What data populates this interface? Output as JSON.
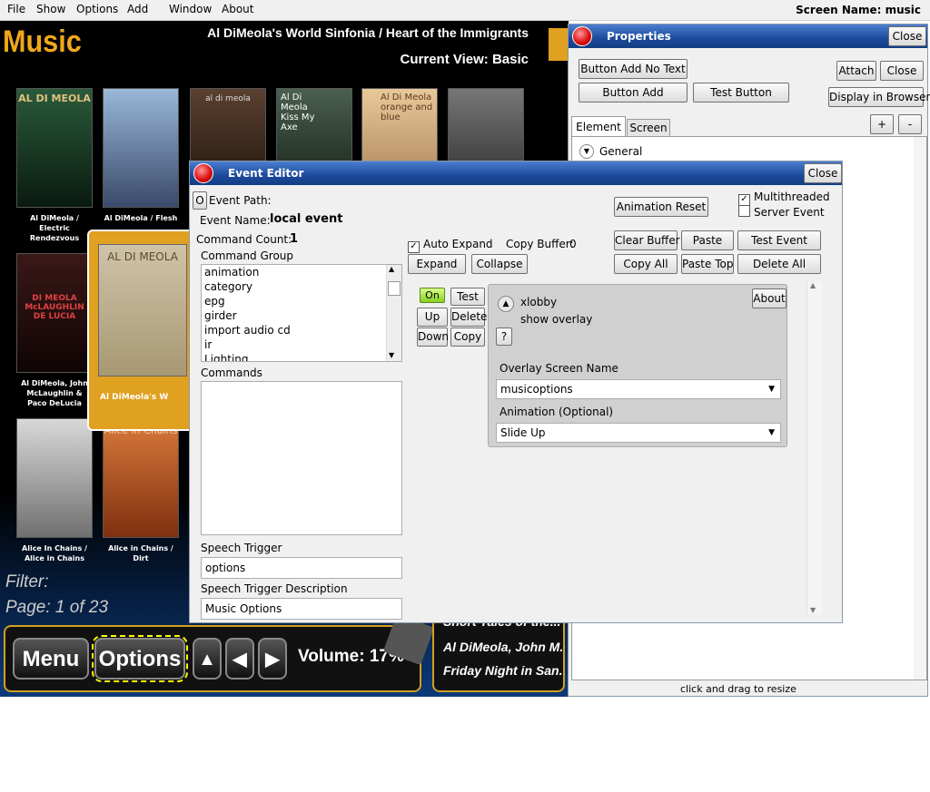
{
  "menubar": {
    "items": [
      "File",
      "Show",
      "Options",
      "Add",
      "Window",
      "About"
    ],
    "screen_name": "Screen Name: music"
  },
  "music": {
    "title": "Music",
    "now_playing": "Al DiMeola's World Sinfonia / Heart of the Immigrants",
    "current_view": "Current View: Basic",
    "albums": [
      {
        "caption": "Al DiMeola / Electric Rendezvous",
        "color": "#1a3a2a",
        "cover_text": "AL DI MEOLA"
      },
      {
        "caption": "Al DiMeola / Flesh on Flesh",
        "color": "#6a8aa8",
        "cover_text": ""
      },
      {
        "caption": "",
        "color": "#3a2a20",
        "cover_text": "al di meola"
      },
      {
        "caption": "",
        "color": "#2a3a30",
        "cover_text": "Al Di Meola Kiss My Axe"
      },
      {
        "caption": "",
        "color": "#c8a070",
        "cover_text": "Al Di Meola orange and blue"
      },
      {
        "caption": "",
        "color": "#444444",
        "cover_text": ""
      },
      {
        "caption": "Al DiMeola, John McLaughlin & Paco DeLucia",
        "color": "#2a1010",
        "cover_text": "DI MEOLA McLAUGHLIN DE LUCIA"
      },
      {
        "caption": "Alice In Chains / Alice in Chains",
        "color": "#bbbbbb",
        "cover_text": ""
      },
      {
        "caption": "Alice in Chains / Dirt",
        "color": "#c06030",
        "cover_text": "Alice in Chains"
      }
    ],
    "selected_album": {
      "caption": "Al DiMeola's W",
      "cover_text": "AL DI MEOLA"
    },
    "filter": "Filter:",
    "page": "Page: 1 of 23",
    "menu_btn": "Menu",
    "options_btn": "Options",
    "volume": "Volume: 17%",
    "np_lines": [
      "Short Tales of the...",
      "Al DiMeola, John M...",
      "Friday Night in San..."
    ]
  },
  "properties": {
    "title": "Properties",
    "close_top": "Close",
    "btn_add_no_text": "Button Add No Text",
    "btn_add": "Button Add",
    "test_button": "Test Button",
    "attach": "Attach",
    "close": "Close",
    "display_browser": "Display in Browser",
    "plus": "+",
    "minus": "-",
    "tab_element": "Element",
    "tab_screen": "Screen",
    "general": "General",
    "resize_hint": "click and drag to resize"
  },
  "event_editor": {
    "title": "Event Editor",
    "close": "Close",
    "o_btn": "O",
    "event_path": "Event Path:",
    "event_name_label": "Event Name:",
    "event_name": "local event",
    "command_count_label": "Command Count:",
    "command_count": "1",
    "command_group_label": "Command Group",
    "command_groups": [
      "animation",
      "category",
      "epg",
      "girder",
      "import audio cd",
      "ir",
      "Lighting"
    ],
    "commands_label": "Commands",
    "speech_trigger_label": "Speech Trigger",
    "speech_trigger": "options",
    "speech_desc_label": "Speech Trigger Description",
    "speech_desc": "Music Options",
    "auto_expand": "Auto Expand",
    "copy_buffer": "Copy Buffer:",
    "copy_buffer_val": "0",
    "expand": "Expand",
    "collapse": "Collapse",
    "animation_reset": "Animation Reset",
    "multithreaded": "Multithreaded",
    "server_event": "Server Event",
    "clear_buffer": "Clear Buffer",
    "paste": "Paste",
    "test_event": "Test Event",
    "copy_all": "Copy All",
    "paste_top": "Paste Top",
    "delete_all": "Delete All",
    "on": "On",
    "test": "Test",
    "up": "Up",
    "delete": "Delete",
    "down": "Down",
    "copy": "Copy",
    "about": "About",
    "cmd_plugin": "xlobby",
    "cmd_action": "show overlay",
    "help": "?",
    "overlay_label": "Overlay Screen Name",
    "overlay_value": "musicoptions",
    "animation_label": "Animation (Optional)",
    "animation_value": "Slide Up"
  }
}
